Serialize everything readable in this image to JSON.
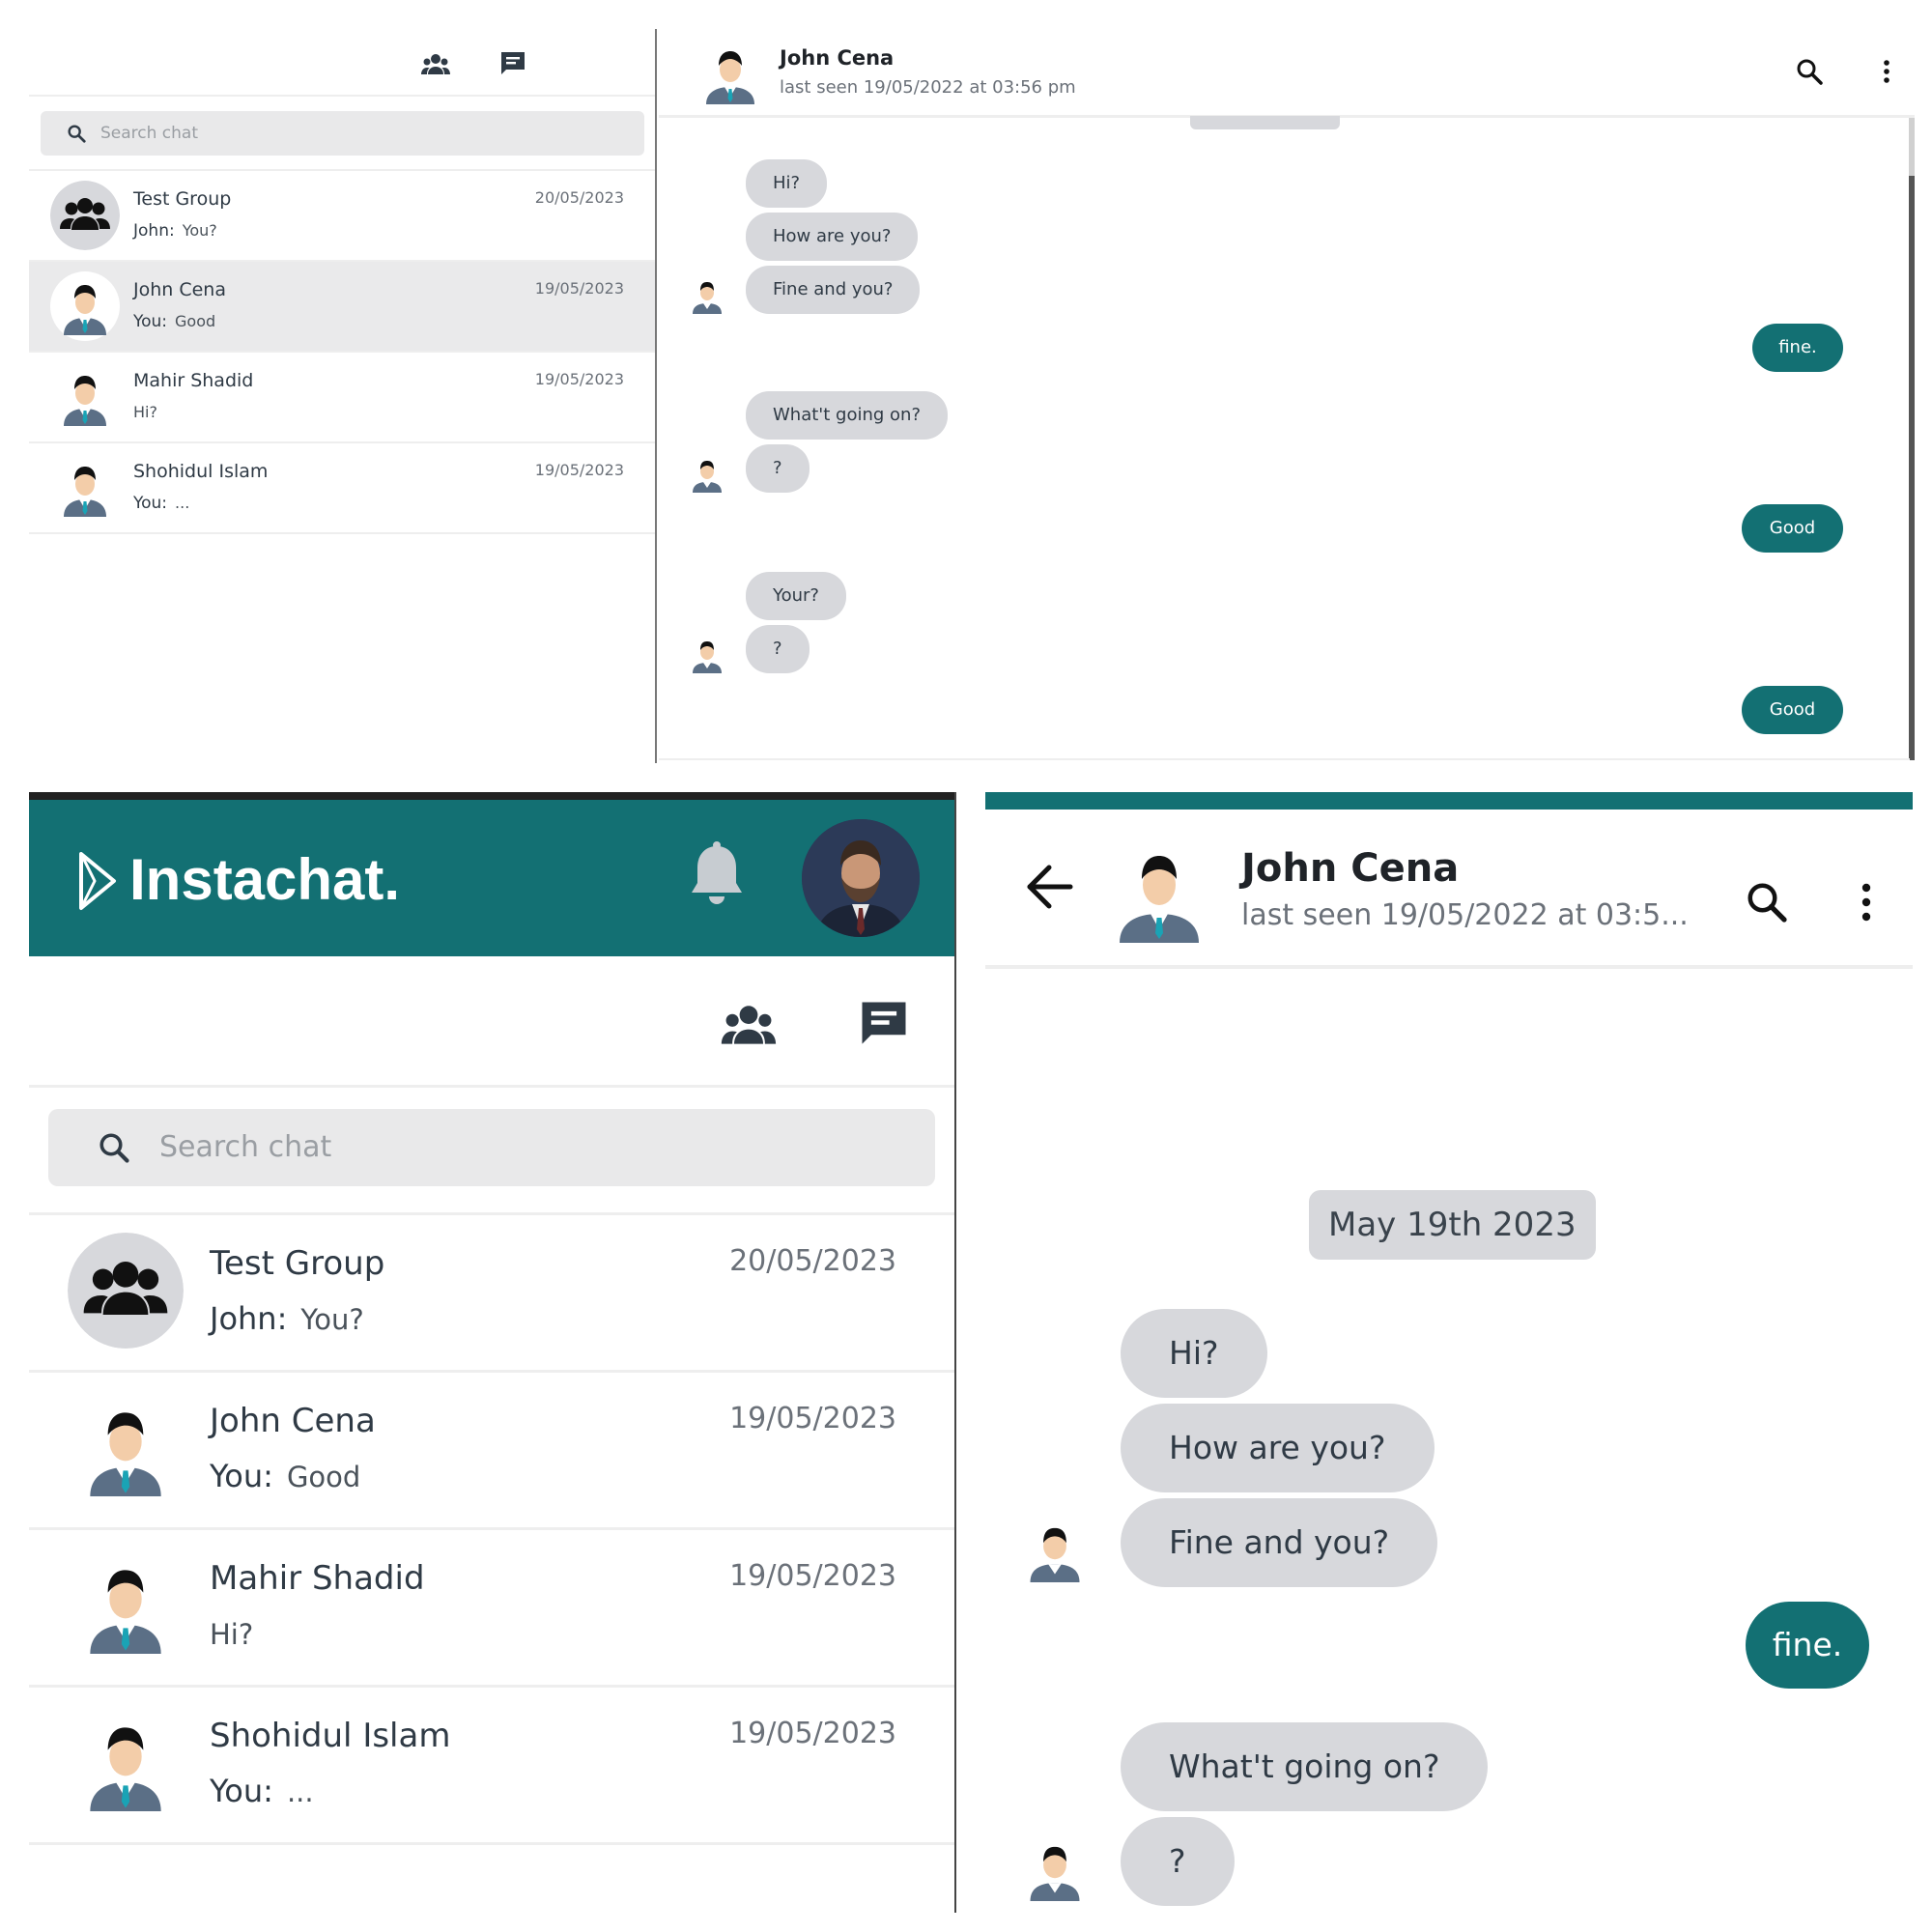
{
  "app": {
    "brand": "Instachat.",
    "search_placeholder": "Search chat",
    "colors": {
      "accent": "#137073",
      "bubble_incoming": "#d7d8dc",
      "search_bg": "#e9e9ea",
      "active_row": "#eaeaeb"
    }
  },
  "chats": [
    {
      "name": "Test Group",
      "sender": "John:",
      "message": "You?",
      "date": "20/05/2023",
      "avatar": "group-icon"
    },
    {
      "name": "John Cena",
      "sender": "You:",
      "message": "Good",
      "date": "19/05/2023",
      "avatar": "user-avatar"
    },
    {
      "name": "Mahir Shadid",
      "sender": "",
      "message": "Hi?",
      "date": "19/05/2023",
      "avatar": "user-avatar"
    },
    {
      "name": "Shohidul Islam",
      "sender": "You:",
      "message": "...",
      "date": "19/05/2023",
      "avatar": "user-avatar"
    }
  ],
  "conversation": {
    "name": "John Cena",
    "last_seen_full": "last seen 19/05/2022 at 03:56 pm",
    "last_seen_short": "last seen 19/05/2022 at 03:5...",
    "date_chip": "May 19th 2023",
    "messages": [
      {
        "from": "them",
        "text": "Hi?"
      },
      {
        "from": "them",
        "text": "How are you?"
      },
      {
        "from": "them",
        "text": "Fine and you?"
      },
      {
        "from": "me",
        "text": "fine."
      },
      {
        "from": "them",
        "text": "What't going on?"
      },
      {
        "from": "them",
        "text": "?"
      },
      {
        "from": "me",
        "text": "Good"
      },
      {
        "from": "them",
        "text": "Your?"
      },
      {
        "from": "them",
        "text": "?"
      },
      {
        "from": "me",
        "text": "Good"
      }
    ]
  }
}
